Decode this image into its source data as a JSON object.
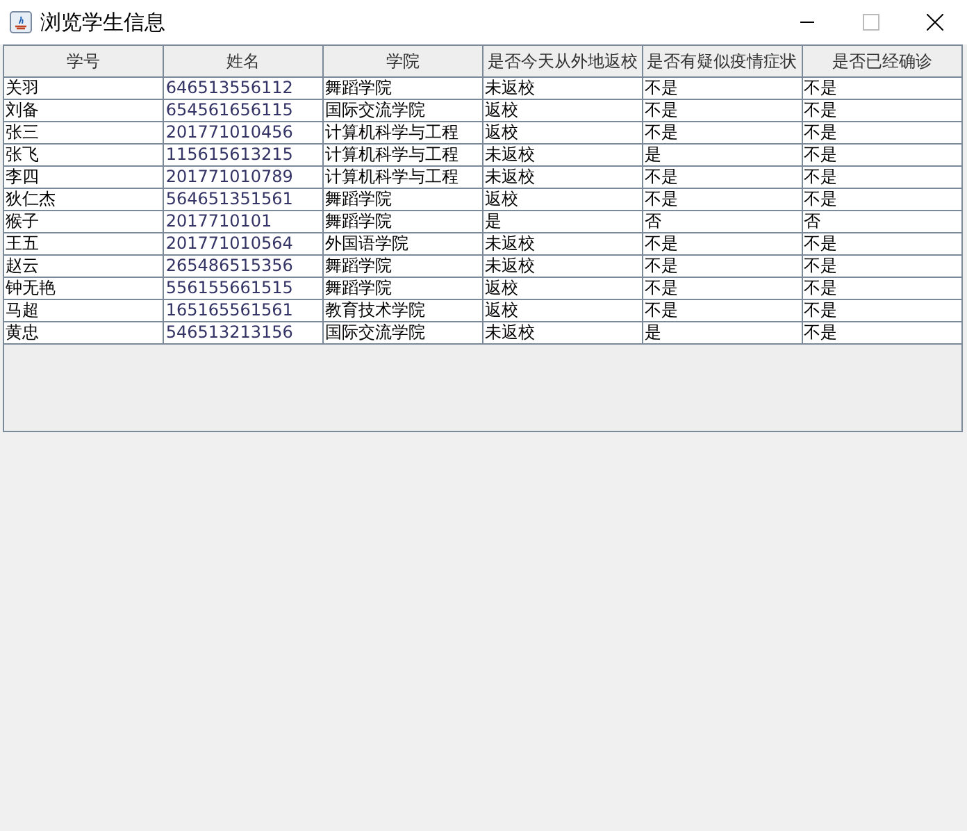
{
  "window": {
    "title": "浏览学生信息"
  },
  "table": {
    "columns": [
      "学号",
      "姓名",
      "学院",
      "是否今天从外地返校",
      "是否有疑似疫情症状",
      "是否已经确诊"
    ],
    "rows": [
      [
        "关羽",
        "646513556112",
        "舞蹈学院",
        "未返校",
        "不是",
        "不是"
      ],
      [
        "刘备",
        "654561656115",
        "国际交流学院",
        "返校",
        "不是",
        "不是"
      ],
      [
        "张三",
        "201771010456",
        "计算机科学与工程",
        "返校",
        "不是",
        "不是"
      ],
      [
        "张飞",
        "115615613215",
        "计算机科学与工程",
        "未返校",
        "是",
        "不是"
      ],
      [
        "李四",
        "201771010789",
        "计算机科学与工程",
        "未返校",
        "不是",
        "不是"
      ],
      [
        "狄仁杰",
        "564651351561",
        "舞蹈学院",
        "返校",
        "不是",
        "不是"
      ],
      [
        "猴子",
        "2017710101",
        "舞蹈学院",
        "是",
        "否",
        "否"
      ],
      [
        "王五",
        "201771010564",
        "外国语学院",
        "未返校",
        "不是",
        "不是"
      ],
      [
        "赵云",
        "265486515356",
        "舞蹈学院",
        "未返校",
        "不是",
        "不是"
      ],
      [
        "钟无艳",
        "556155661515",
        "舞蹈学院",
        "返校",
        "不是",
        "不是"
      ],
      [
        "马超",
        "165165561561",
        "教育技术学院",
        "返校",
        "不是",
        "不是"
      ],
      [
        "黄忠",
        "546513213156",
        "国际交流学院",
        "未返校",
        "是",
        "不是"
      ]
    ]
  }
}
